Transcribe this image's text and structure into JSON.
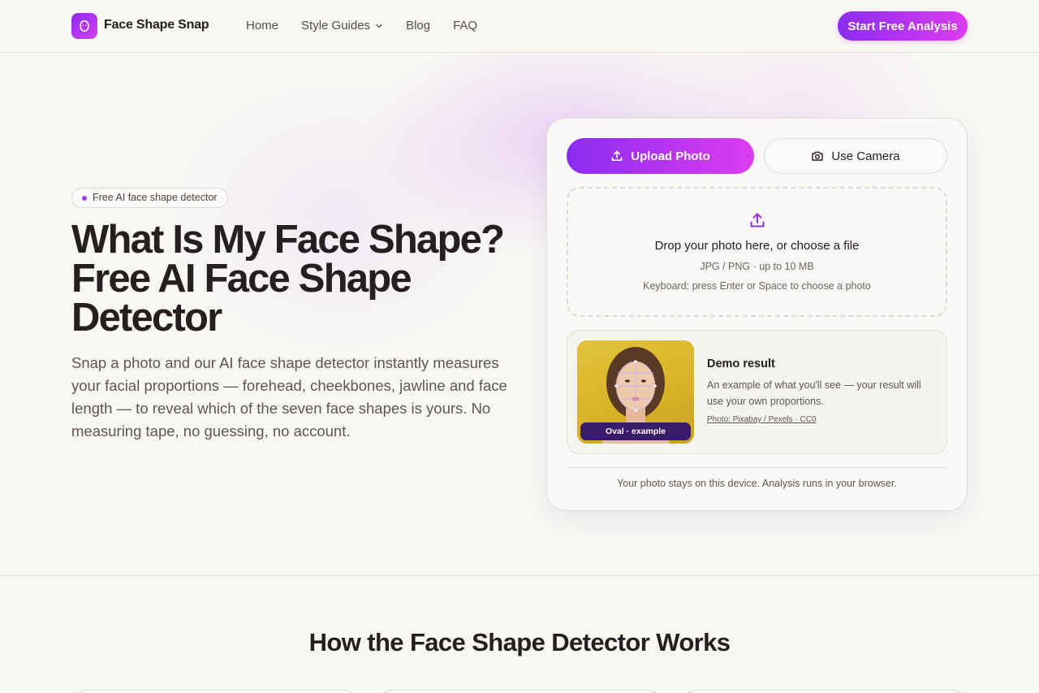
{
  "header": {
    "brand": "Face Shape Snap",
    "nav": [
      {
        "label": "Home"
      },
      {
        "label": "Style Guides",
        "has_dropdown": true
      },
      {
        "label": "Blog"
      },
      {
        "label": "FAQ"
      }
    ],
    "cta_label": "Start Free Analysis"
  },
  "hero": {
    "badge": "Free AI face shape detector",
    "title": "What Is My Face Shape? Free AI Face Shape Detector",
    "subtitle": "Snap a photo and our AI face shape detector instantly measures your facial proportions — forehead, cheekbones, jawline and face length — to reveal which of the seven face shapes is yours. No measuring tape, no guessing, no account."
  },
  "uploader": {
    "upload_label": "Upload Photo",
    "camera_label": "Use Camera",
    "dropzone": {
      "title": "Drop your photo here, or choose a file",
      "types": "JPG / PNG · up to 10 MB",
      "keyboard_hint": "Keyboard: press Enter or Space to choose a photo"
    },
    "demo": {
      "tag": "Oval · example",
      "title": "Demo result",
      "description": "An example of what you'll see — your result will use your own proportions.",
      "credit": "Photo: Pixabay / Pexels · CC0"
    },
    "privacy": "Your photo stays on this device. Analysis runs in your browser."
  },
  "how_it_works": {
    "title": "How the Face Shape Detector Works"
  },
  "colors": {
    "accent_start": "#8a2cf0",
    "accent_end": "#dd3cf0",
    "background": "#f8f7f4",
    "text": "#24201f"
  },
  "icons": [
    "face-logo-icon",
    "chevron-down-icon",
    "upload-icon",
    "camera-icon"
  ]
}
